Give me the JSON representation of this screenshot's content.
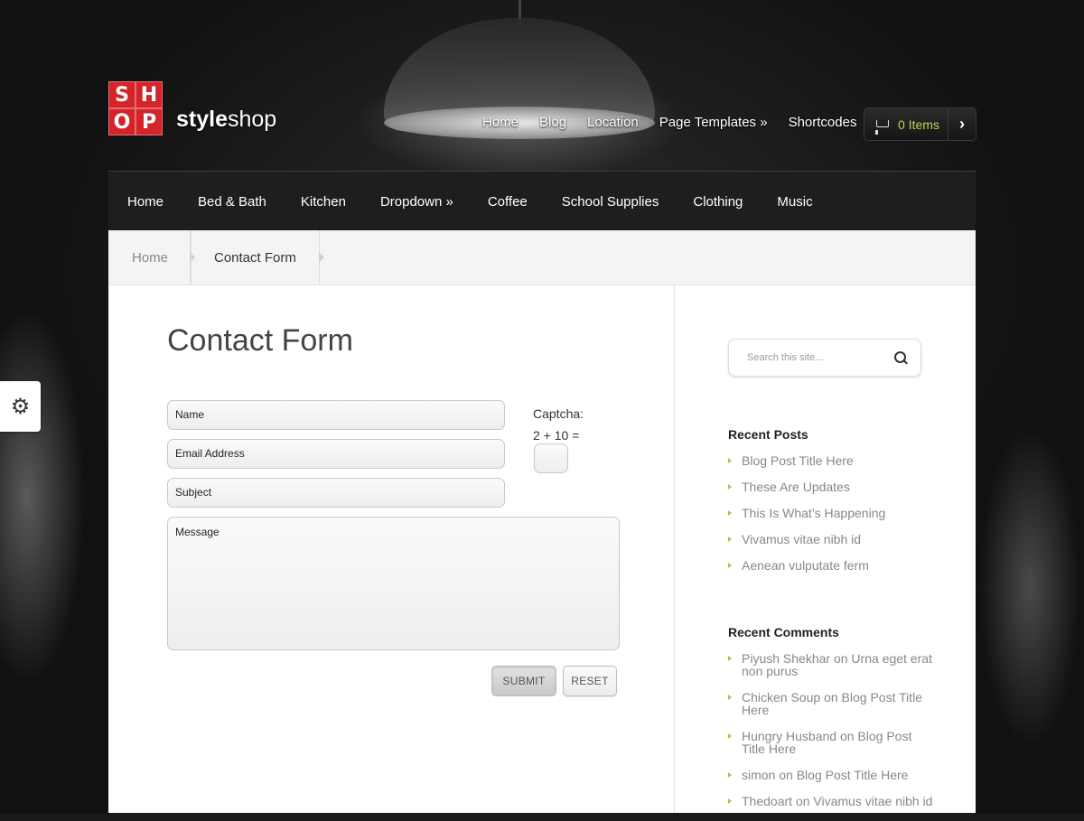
{
  "brand": {
    "logo_letters": [
      "S",
      "H",
      "O",
      "P"
    ],
    "name_bold": "style",
    "name_light": "shop"
  },
  "top_nav": [
    "Home",
    "Blog",
    "Location",
    "Page Templates »",
    "Shortcodes"
  ],
  "cart": {
    "label": "0 Items",
    "icon": "cart-icon",
    "arrow": "›"
  },
  "main_nav": [
    "Home",
    "Bed & Bath",
    "Kitchen",
    "Dropdown »",
    "Coffee",
    "School Supplies",
    "Clothing",
    "Music"
  ],
  "breadcrumb": {
    "home": "Home",
    "current": "Contact Form"
  },
  "page": {
    "title": "Contact Form"
  },
  "form": {
    "name_placeholder": "Name",
    "email_placeholder": "Email Address",
    "subject_placeholder": "Subject",
    "message_placeholder": "Message",
    "captcha_label": "Captcha:",
    "captcha_question": "2 + 10 =",
    "submit_label": "SUBMIT",
    "reset_label": "RESET"
  },
  "sidebar": {
    "search_placeholder": "Search this site...",
    "recent_posts_title": "Recent Posts",
    "recent_posts": [
      "Blog Post Title Here",
      "These Are Updates",
      "This Is What’s Happening",
      "Vivamus vitae nibh id",
      "Aenean vulputate ferm"
    ],
    "recent_comments_title": "Recent Comments",
    "recent_comments": [
      {
        "author": "Piyush Shekhar",
        "sep": "on",
        "post": "Urna eget erat non purus"
      },
      {
        "author": "Chicken Soup",
        "sep": "on",
        "post": "Blog Post Title Here"
      },
      {
        "author": "Hungry Husband",
        "sep": "on",
        "post": "Blog Post Title Here"
      },
      {
        "author": "simon",
        "sep": "on",
        "post": "Blog Post Title Here"
      },
      {
        "author": "Thedoart",
        "sep": "on",
        "post": "Vivamus vitae nibh id"
      }
    ]
  },
  "settings_tab": {
    "icon": "gear-icon",
    "glyph": "⚙"
  },
  "colors": {
    "accent": "#d5232a",
    "cart_text": "#c3d05a",
    "bullet": "#a9c83a",
    "nav_bg": "#1e1e1e"
  }
}
